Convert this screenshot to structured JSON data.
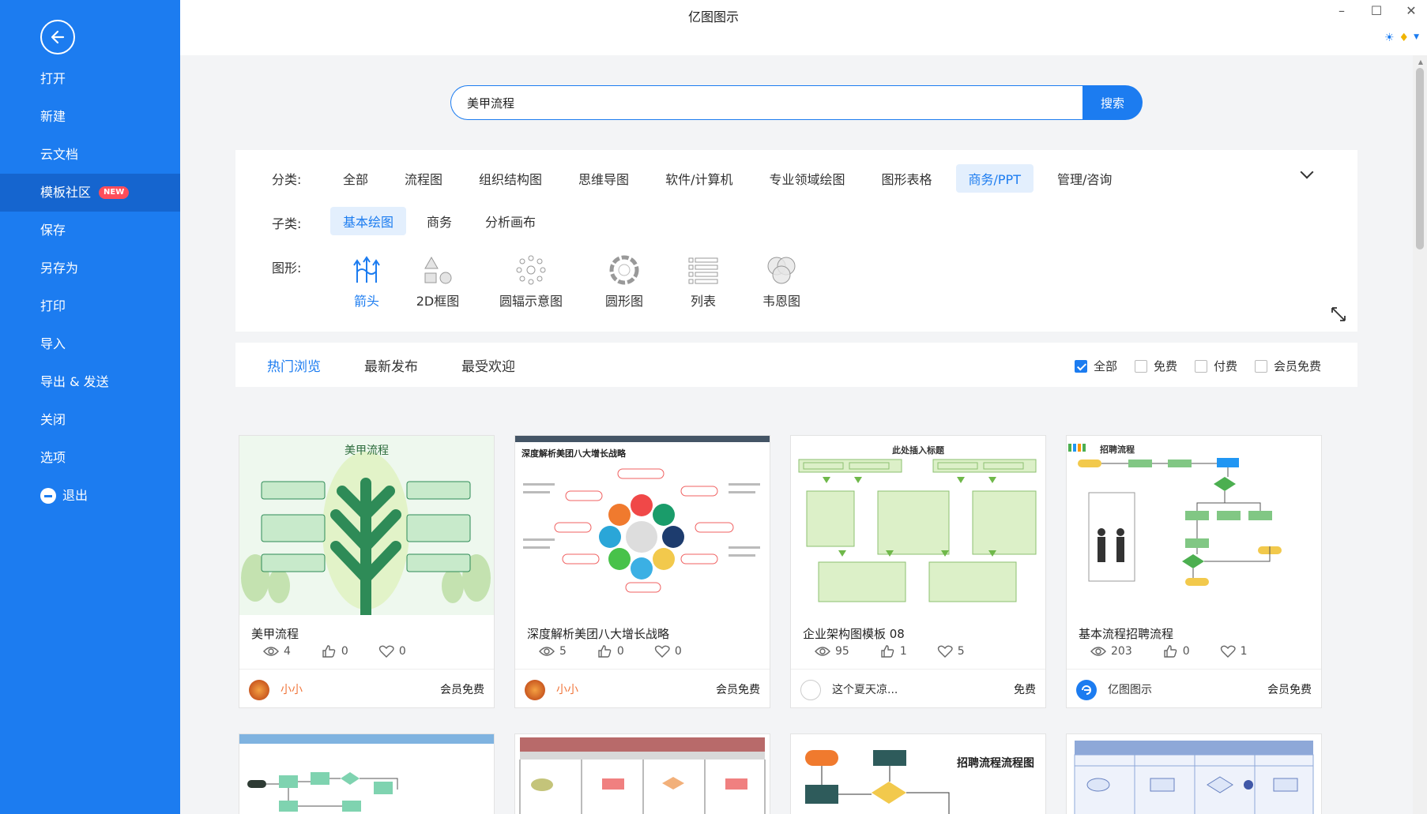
{
  "app": {
    "title": "亿图图示"
  },
  "sidebar": {
    "items": [
      {
        "label": "打开"
      },
      {
        "label": "新建"
      },
      {
        "label": "云文档"
      },
      {
        "label": "模板社区",
        "badge": "NEW"
      },
      {
        "label": "保存"
      },
      {
        "label": "另存为"
      },
      {
        "label": "打印"
      },
      {
        "label": "导入"
      },
      {
        "label": "导出 & 发送"
      },
      {
        "label": "关闭"
      },
      {
        "label": "选项"
      },
      {
        "label": "退出"
      }
    ]
  },
  "search": {
    "value": "美甲流程",
    "button": "搜索"
  },
  "filters": {
    "category_label": "分类:",
    "categories": [
      "全部",
      "流程图",
      "组织结构图",
      "思维导图",
      "软件/计算机",
      "专业领域绘图",
      "图形表格",
      "商务/PPT",
      "管理/咨询"
    ],
    "subcategory_label": "子类:",
    "subcategories": [
      "基本绘图",
      "商务",
      "分析画布"
    ],
    "shape_label": "图形:",
    "shapes": [
      "箭头",
      "2D框图",
      "圆辐示意图",
      "圆形图",
      "列表",
      "韦恩图"
    ]
  },
  "sort": {
    "tabs": [
      "热门浏览",
      "最新发布",
      "最受欢迎"
    ],
    "price_filters": [
      "全部",
      "免费",
      "付费",
      "会员免费"
    ]
  },
  "cards": [
    {
      "title": "美甲流程",
      "thumb_title": "美甲流程",
      "views": "4",
      "likes": "0",
      "favs": "0",
      "author": "小小",
      "price": "会员免费"
    },
    {
      "title": "深度解析美团八大增长战略",
      "thumb_title": "深度解析美团八大增长战略",
      "views": "5",
      "likes": "0",
      "favs": "0",
      "author": "小小",
      "price": "会员免费"
    },
    {
      "title": "企业架构图模板 08",
      "thumb_title": "此处插入标题",
      "views": "95",
      "likes": "1",
      "favs": "5",
      "author": "这个夏天凉...",
      "price": "免费"
    },
    {
      "title": "基本流程招聘流程",
      "thumb_title": "招聘流程",
      "views": "203",
      "likes": "0",
      "favs": "1",
      "author": "亿图图示",
      "price": "会员免费"
    }
  ],
  "row2": [
    {
      "thumb_title": ""
    },
    {
      "thumb_title": ""
    },
    {
      "thumb_title": "招聘流程流程图"
    },
    {
      "thumb_title": ""
    }
  ],
  "colors": {
    "accent": "#1c7cf0",
    "sidebar_active": "#1565cf",
    "badge": "#ff4d5a",
    "author": "#f0753a"
  }
}
